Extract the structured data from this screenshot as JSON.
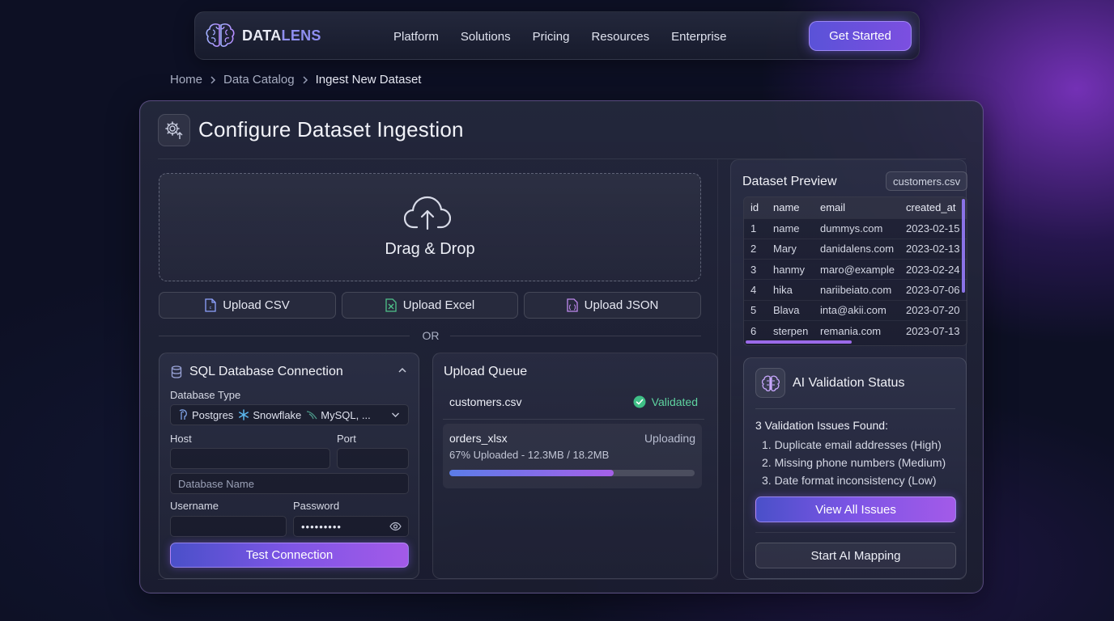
{
  "nav": {
    "logo_part1": "DATA",
    "logo_part2": "LENS",
    "logo_icon": "brain-icon",
    "links": [
      "Platform",
      "Solutions",
      "Pricing",
      "Resources",
      "Enterprise"
    ],
    "cta": "Get Started"
  },
  "breadcrumb": [
    "Home",
    "Data Catalog",
    "Ingest New Dataset"
  ],
  "page": {
    "title": "Configure Dataset Ingestion",
    "title_icon": "gear-upload-icon"
  },
  "dropzone": {
    "label": "Drag & Drop",
    "icon": "cloud-upload-icon"
  },
  "upload_buttons": [
    {
      "label": "Upload CSV",
      "icon": "csv-file-icon",
      "color": "#8ea2ff"
    },
    {
      "label": "Upload Excel",
      "icon": "excel-file-icon",
      "color": "#4fc38a"
    },
    {
      "label": "Upload JSON",
      "icon": "json-file-icon",
      "color": "#c08af0"
    }
  ],
  "or_label": "OR",
  "sql": {
    "title": "SQL Database Connection",
    "db_type_label": "Database Type",
    "db_options": [
      "Postgres",
      "Snowflake",
      "MySQL, ..."
    ],
    "host_label": "Host",
    "port_label": "Port",
    "host_value": "",
    "port_value": "",
    "db_name_placeholder": "Database Name",
    "username_label": "Username",
    "password_label": "Password",
    "username_value": "",
    "password_value": "•••••••••",
    "test_button": "Test Connection"
  },
  "queue": {
    "title": "Upload Queue",
    "items": [
      {
        "file": "customers.csv",
        "status": "Validated"
      },
      {
        "file": "orders_xlsx",
        "status": "Uploading",
        "progress_text": "67% Uploaded - 12.3MB / 18.2MB",
        "progress": 0.67
      }
    ]
  },
  "preview": {
    "title": "Dataset Preview",
    "file_chip": "customers.csv",
    "columns": [
      "id",
      "name",
      "email",
      "created_at"
    ],
    "rows": [
      [
        "1",
        "name",
        "dummys.com",
        "2023-02-15"
      ],
      [
        "2",
        "Mary",
        "danidalens.com",
        "2023-02-13"
      ],
      [
        "3",
        "hanmy",
        "maro@example",
        "2023-02-24"
      ],
      [
        "4",
        "hika",
        "nariibeiato.com",
        "2023-07-06"
      ],
      [
        "5",
        "Blava",
        "inta@akii.com",
        "2023-07-20"
      ],
      [
        "6",
        "sterpen",
        "remania.com",
        "2023-07-13"
      ]
    ]
  },
  "ai": {
    "title": "AI Validation Status",
    "icon": "ai-brain-icon",
    "summary": "3 Validation Issues Found:",
    "issues": [
      "1. Duplicate email addresses (High)",
      "2. Missing phone numbers (Medium)",
      "3. Date format inconsistency (Low)"
    ],
    "view_button": "View All Issues",
    "mapping_button": "Start AI Mapping"
  },
  "colors": {
    "accent": "#7c4fe0",
    "success": "#5fd3a0",
    "background": "#0d1024"
  }
}
